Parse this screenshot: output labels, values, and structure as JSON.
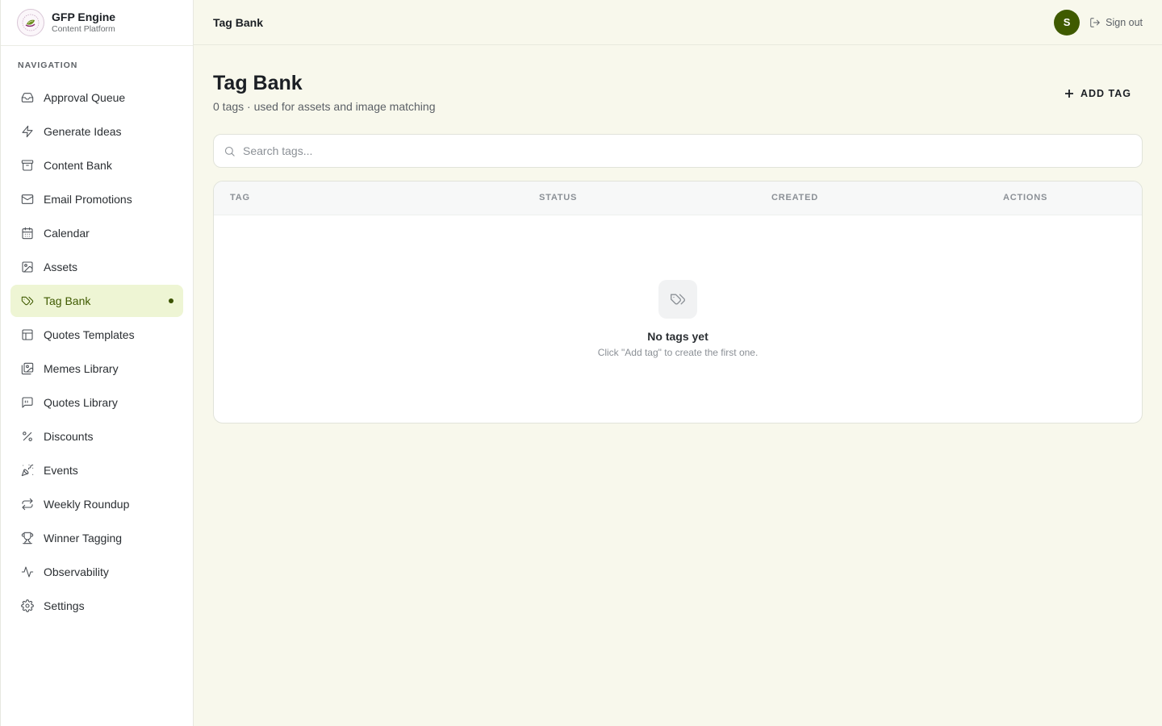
{
  "brand": {
    "title": "GFP Engine",
    "subtitle": "Content Platform",
    "logo_icon": "leaf-logo-icon"
  },
  "sidebar": {
    "heading": "NAVIGATION",
    "items": [
      {
        "label": "Approval Queue",
        "icon": "inbox-icon"
      },
      {
        "label": "Generate Ideas",
        "icon": "lightning-icon"
      },
      {
        "label": "Content Bank",
        "icon": "archive-icon"
      },
      {
        "label": "Email Promotions",
        "icon": "mail-icon"
      },
      {
        "label": "Calendar",
        "icon": "calendar-icon"
      },
      {
        "label": "Assets",
        "icon": "image-icon"
      },
      {
        "label": "Tag Bank",
        "icon": "tags-icon",
        "active": true
      },
      {
        "label": "Quotes Templates",
        "icon": "layout-icon"
      },
      {
        "label": "Memes Library",
        "icon": "images-icon"
      },
      {
        "label": "Quotes Library",
        "icon": "message-quote-icon"
      },
      {
        "label": "Discounts",
        "icon": "percent-icon"
      },
      {
        "label": "Events",
        "icon": "party-popper-icon"
      },
      {
        "label": "Weekly Roundup",
        "icon": "repeat-icon"
      },
      {
        "label": "Winner Tagging",
        "icon": "trophy-icon"
      },
      {
        "label": "Observability",
        "icon": "activity-icon"
      },
      {
        "label": "Settings",
        "icon": "gear-icon"
      }
    ]
  },
  "topbar": {
    "title": "Tag Bank",
    "avatar_initial": "S",
    "signout_label": "Sign out"
  },
  "page": {
    "title": "Tag Bank",
    "subtitle": "0 tags · used for assets and image matching",
    "add_button_label": "ADD TAG"
  },
  "search": {
    "placeholder": "Search tags...",
    "value": ""
  },
  "table": {
    "columns": [
      "TAG",
      "STATUS",
      "CREATED",
      "ACTIONS"
    ],
    "rows": []
  },
  "empty_state": {
    "title": "No tags yet",
    "message": "Click \"Add tag\" to create the first one.",
    "icon": "tags-icon"
  },
  "colors": {
    "accent": "#3f5a00",
    "active_bg": "#eef5d4",
    "page_bg": "#f8f8ec"
  }
}
